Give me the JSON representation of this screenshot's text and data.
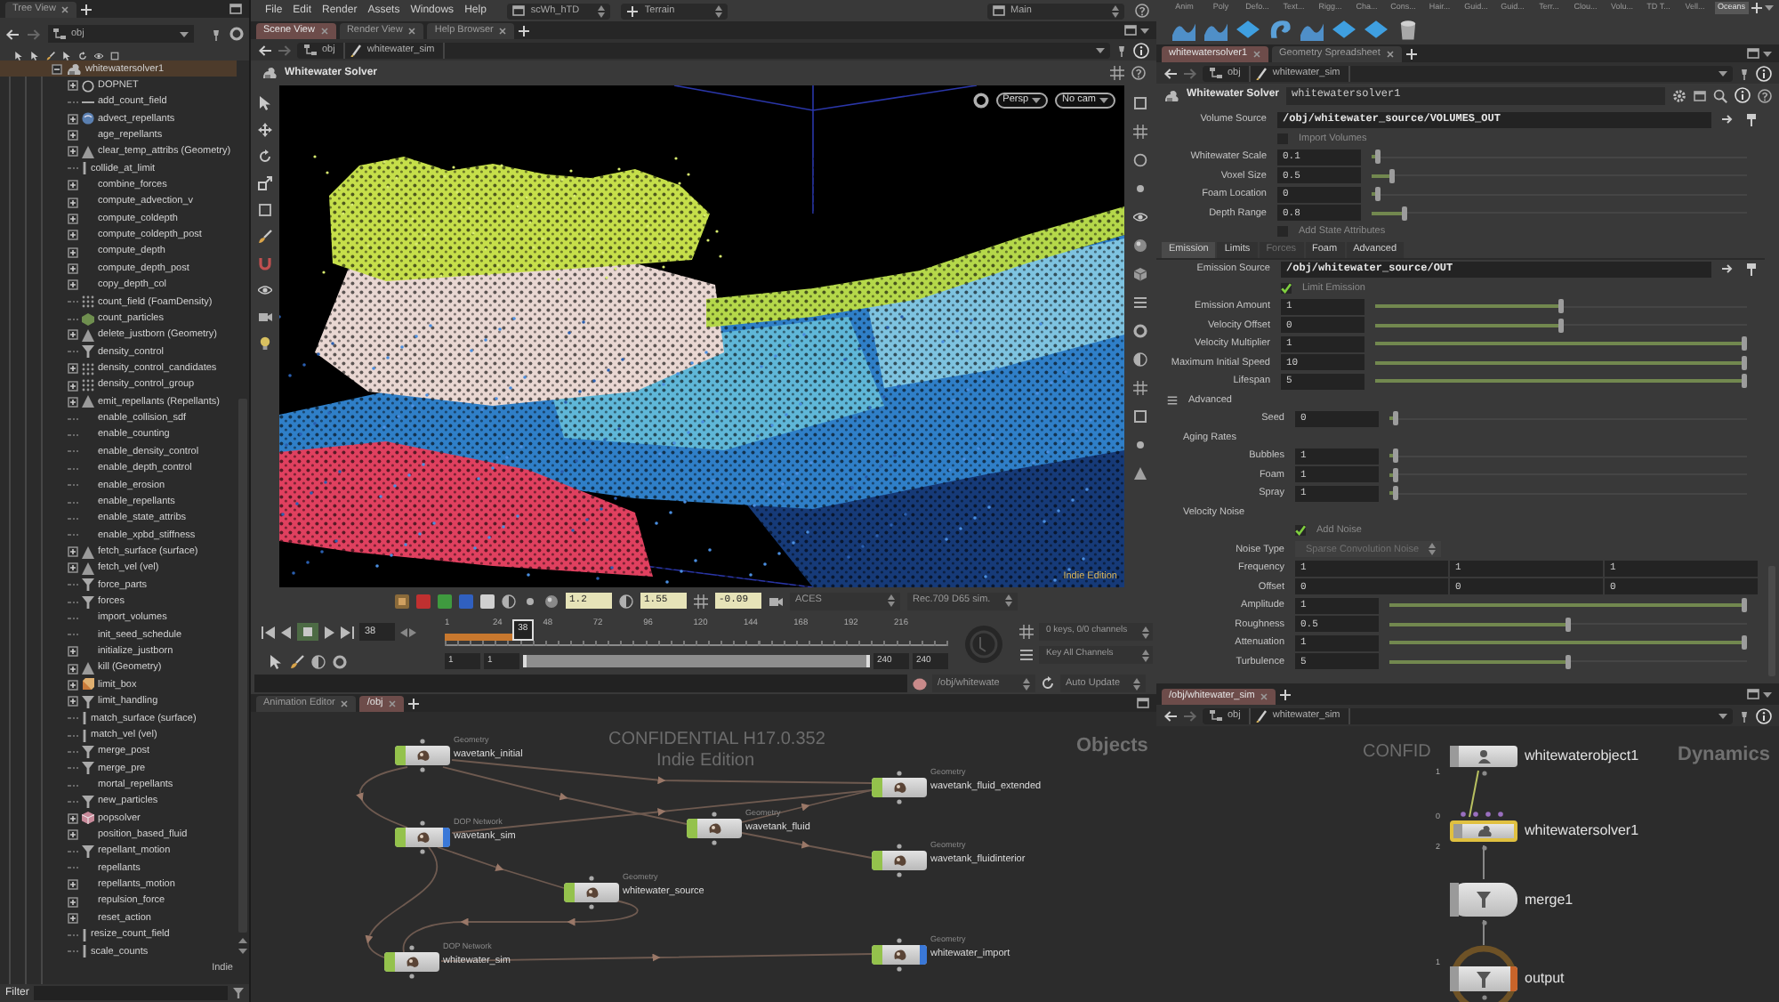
{
  "tree_view": {
    "tab": "Tree View",
    "path": "obj",
    "root": {
      "label": "whitewatersolver1",
      "expanded": true,
      "selected": true,
      "children": [
        {
          "label": "DOPNET",
          "expandable": true,
          "kind": "dopnet",
          "selected": false
        },
        {
          "label": "add_count_field",
          "expandable": false,
          "kind": "dash",
          "selected": false
        },
        {
          "label": "advect_repellants",
          "expandable": true,
          "kind": "sphere",
          "selected": false
        },
        {
          "label": "age_repellants",
          "expandable": true,
          "kind": "none",
          "selected": false
        },
        {
          "label": "clear_temp_attribs (Geometry)",
          "expandable": true,
          "kind": "cone",
          "selected": false
        },
        {
          "label": "collide_at_limit",
          "expandable": false,
          "kind": "bar",
          "selected": false
        },
        {
          "label": "combine_forces",
          "expandable": true,
          "kind": "none",
          "selected": false
        },
        {
          "label": "compute_advection_v",
          "expandable": true,
          "kind": "none",
          "selected": false
        },
        {
          "label": "compute_coldepth",
          "expandable": true,
          "kind": "none",
          "selected": false
        },
        {
          "label": "compute_coldepth_post",
          "expandable": true,
          "kind": "none",
          "selected": false
        },
        {
          "label": "compute_depth",
          "expandable": true,
          "kind": "none",
          "selected": false
        },
        {
          "label": "compute_depth_post",
          "expandable": true,
          "kind": "none",
          "selected": false
        },
        {
          "label": "copy_depth_col",
          "expandable": true,
          "kind": "none",
          "selected": false
        },
        {
          "label": "count_field (FoamDensity)",
          "expandable": false,
          "kind": "dots",
          "selected": false
        },
        {
          "label": "count_particles",
          "expandable": false,
          "kind": "hexagon",
          "selected": false
        },
        {
          "label": "delete_justborn (Geometry)",
          "expandable": true,
          "kind": "cone",
          "selected": false
        },
        {
          "label": "density_control",
          "expandable": false,
          "kind": "funnel",
          "selected": false
        },
        {
          "label": "density_control_candidates",
          "expandable": true,
          "kind": "dots",
          "selected": false
        },
        {
          "label": "density_control_group",
          "expandable": true,
          "kind": "dots",
          "selected": false
        },
        {
          "label": "emit_repellants (Repellants)",
          "expandable": true,
          "kind": "cone",
          "selected": false
        },
        {
          "label": "enable_collision_sdf",
          "expandable": false,
          "kind": "none",
          "selected": false
        },
        {
          "label": "enable_counting",
          "expandable": false,
          "kind": "none",
          "selected": false
        },
        {
          "label": "enable_density_control",
          "expandable": false,
          "kind": "none",
          "selected": false
        },
        {
          "label": "enable_depth_control",
          "expandable": false,
          "kind": "none",
          "selected": false
        },
        {
          "label": "enable_erosion",
          "expandable": false,
          "kind": "none",
          "selected": false
        },
        {
          "label": "enable_repellants",
          "expandable": false,
          "kind": "none",
          "selected": false
        },
        {
          "label": "enable_state_attribs",
          "expandable": false,
          "kind": "none",
          "selected": false
        },
        {
          "label": "enable_xpbd_stiffness",
          "expandable": false,
          "kind": "none",
          "selected": false
        },
        {
          "label": "fetch_surface (surface)",
          "expandable": true,
          "kind": "cone",
          "selected": false
        },
        {
          "label": "fetch_vel (vel)",
          "expandable": true,
          "kind": "cone",
          "selected": false
        },
        {
          "label": "force_parts",
          "expandable": false,
          "kind": "funnel",
          "selected": false
        },
        {
          "label": "forces",
          "expandable": false,
          "kind": "funnel",
          "selected": false
        },
        {
          "label": "import_volumes",
          "expandable": false,
          "kind": "none",
          "selected": false
        },
        {
          "label": "init_seed_schedule",
          "expandable": false,
          "kind": "none",
          "selected": false
        },
        {
          "label": "initialize_justborn",
          "expandable": true,
          "kind": "none",
          "selected": false
        },
        {
          "label": "kill (Geometry)",
          "expandable": true,
          "kind": "cone",
          "selected": false
        },
        {
          "label": "limit_box",
          "expandable": true,
          "kind": "box",
          "selected": false
        },
        {
          "label": "limit_handling",
          "expandable": true,
          "kind": "funnel",
          "selected": false
        },
        {
          "label": "match_surface (surface)",
          "expandable": false,
          "kind": "bar",
          "selected": false
        },
        {
          "label": "match_vel (vel)",
          "expandable": false,
          "kind": "bar",
          "selected": false
        },
        {
          "label": "merge_post",
          "expandable": false,
          "kind": "funnel",
          "selected": false
        },
        {
          "label": "merge_pre",
          "expandable": false,
          "kind": "funnel",
          "selected": false
        },
        {
          "label": "mortal_repellants",
          "expandable": false,
          "kind": "none",
          "selected": false
        },
        {
          "label": "new_particles",
          "expandable": false,
          "kind": "funnel",
          "selected": false
        },
        {
          "label": "popsolver",
          "expandable": true,
          "kind": "cube",
          "selected": false
        },
        {
          "label": "position_based_fluid",
          "expandable": true,
          "kind": "none",
          "selected": false
        },
        {
          "label": "repellant_motion",
          "expandable": false,
          "kind": "funnel",
          "selected": false
        },
        {
          "label": "repellants",
          "expandable": false,
          "kind": "none",
          "selected": false
        },
        {
          "label": "repellants_motion",
          "expandable": true,
          "kind": "none",
          "selected": false
        },
        {
          "label": "repulsion_force",
          "expandable": true,
          "kind": "none",
          "selected": false
        },
        {
          "label": "reset_action",
          "expandable": true,
          "kind": "none",
          "selected": false
        },
        {
          "label": "resize_count_field",
          "expandable": false,
          "kind": "bar",
          "selected": false
        },
        {
          "label": "scale_counts",
          "expandable": false,
          "kind": "bar",
          "selected": false
        }
      ]
    },
    "edition_label": "Indie",
    "filter_label": "Filter"
  },
  "menu_bar": {
    "items": [
      "File",
      "Edit",
      "Render",
      "Assets",
      "Windows",
      "Help"
    ],
    "desktop": "scWh_hTD",
    "context": "Terrain",
    "workspace": "Main"
  },
  "scene_tabs": [
    {
      "label": "Scene View",
      "selected": true
    },
    {
      "label": "Render View",
      "selected": false
    },
    {
      "label": "Help Browser",
      "selected": false
    }
  ],
  "scene_path": [
    "obj",
    "whitewater_sim"
  ],
  "viewport": {
    "title": "Whitewater Solver",
    "view_menu": "Persp",
    "camera_menu": "No cam",
    "edition_label": "Indie Edition"
  },
  "display_bar": {
    "fields": [
      "1.2",
      "1.55",
      "-0.09"
    ],
    "color_space": "ACES",
    "display": "Rec.709 D65 sim."
  },
  "timeline": {
    "frame": "38",
    "marker": "38",
    "ruler_labels": [
      "1",
      "24",
      "48",
      "72",
      "96",
      "120",
      "144",
      "168",
      "192",
      "216"
    ],
    "level": 0.155,
    "keys_info": "0 keys, 0/0 channels",
    "key_all": "Key All Channels",
    "range": [
      "1",
      "1",
      "240",
      "240"
    ]
  },
  "status_bar": {
    "path": "/obj/whitewate",
    "update_mode": "Auto Update"
  },
  "network_left": {
    "tabs": [
      {
        "label": "Animation Editor",
        "selected": false
      },
      {
        "label": "/obj",
        "selected": true
      }
    ],
    "context_label": "Objects",
    "notice": [
      "CONFIDENTIAL H17.0.352",
      "Indie Edition"
    ],
    "nodes": [
      {
        "type": "Geometry",
        "name": "wavetank_initial",
        "display": false,
        "selected": false
      },
      {
        "type": "DOP Network",
        "name": "wavetank_sim",
        "display": true,
        "selected": false
      },
      {
        "type": "Geometry",
        "name": "wavetank_fluid",
        "display": false,
        "selected": false
      },
      {
        "type": "Geometry",
        "name": "wavetank_fluid_extended",
        "display": false,
        "selected": false
      },
      {
        "type": "Geometry",
        "name": "wavetank_fluidinterior",
        "display": false,
        "selected": false
      },
      {
        "type": "Geometry",
        "name": "whitewater_source",
        "display": false,
        "selected": false
      },
      {
        "type": "DOP Network",
        "name": "whitewater_sim",
        "display": false,
        "selected": false
      },
      {
        "type": "Geometry",
        "name": "whitewater_import",
        "display": true,
        "selected": false
      }
    ]
  },
  "shelf": {
    "tabs": [
      {
        "label": "Anim",
        "selected": false
      },
      {
        "label": "Poly",
        "selected": false
      },
      {
        "label": "Defo...",
        "selected": false
      },
      {
        "label": "Text...",
        "selected": false
      },
      {
        "label": "Rigg...",
        "selected": false
      },
      {
        "label": "Cha...",
        "selected": false
      },
      {
        "label": "Cons...",
        "selected": false
      },
      {
        "label": "Hair...",
        "selected": false
      },
      {
        "label": "Guid...",
        "selected": false
      },
      {
        "label": "Guid...",
        "selected": false
      },
      {
        "label": "Terr...",
        "selected": false
      },
      {
        "label": "Clou...",
        "selected": false
      },
      {
        "label": "Volu...",
        "selected": false
      },
      {
        "label": "TD T...",
        "selected": false
      },
      {
        "label": "Vell...",
        "selected": false
      },
      {
        "label": "Oceans",
        "selected": true
      }
    ]
  },
  "parameter_pane": {
    "tabs": [
      {
        "label": "whitewatersolver1",
        "selected": true
      },
      {
        "label": "Geometry Spreadsheet",
        "selected": false
      }
    ],
    "path": [
      "obj",
      "whitewater_sim"
    ],
    "node_type": "Whitewater Solver",
    "node_name": "whitewatersolver1",
    "params": [
      {
        "kind": "path",
        "label": "Volume Source",
        "value": "/obj/whitewater_source/VOLUMES_OUT"
      },
      {
        "kind": "toggle",
        "label": "Import Volumes",
        "checked": false
      },
      {
        "kind": "slider",
        "label": "Whitewater Scale",
        "value": "0.1",
        "level": 0.01
      },
      {
        "kind": "slider",
        "label": "Voxel Size",
        "value": "0.5",
        "level": 0.05
      },
      {
        "kind": "slider",
        "label": "Foam Location",
        "value": "0",
        "level": 0.01
      },
      {
        "kind": "slider",
        "label": "Depth Range",
        "value": "0.8",
        "level": 0.08
      },
      {
        "kind": "toggle",
        "label": "Add State Attributes",
        "checked": false
      }
    ],
    "folder_tabs": [
      {
        "label": "Emission",
        "selected": true,
        "disabled": false
      },
      {
        "label": "Limits",
        "selected": false,
        "disabled": false
      },
      {
        "label": "Forces",
        "selected": false,
        "disabled": true
      },
      {
        "label": "Foam",
        "selected": false,
        "disabled": false
      },
      {
        "label": "Advanced",
        "selected": false,
        "disabled": false
      }
    ],
    "folder_params": [
      {
        "kind": "path",
        "label": "Emission Source",
        "value": "/obj/whitewater_source/OUT"
      },
      {
        "kind": "toggle",
        "label": "Limit Emission",
        "checked": true
      },
      {
        "kind": "slider",
        "label": "Emission Amount",
        "value": "1",
        "level": 0.5
      },
      {
        "kind": "slider",
        "label": "Velocity Offset",
        "value": "0",
        "level": 0.5
      },
      {
        "kind": "slider",
        "label": "Velocity Multiplier",
        "value": "1",
        "level": 1
      },
      {
        "kind": "slider",
        "label": "Maximum Initial Speed",
        "value": "10",
        "level": 1
      },
      {
        "kind": "slider",
        "label": "Lifespan",
        "value": "5",
        "level": 1
      }
    ],
    "advanced": {
      "label": "Advanced",
      "expanded": true,
      "params": [
        {
          "kind": "slider",
          "label": "Seed",
          "value": "0",
          "level": 0.01
        },
        {
          "kind": "heading",
          "label": "Aging Rates"
        },
        {
          "kind": "slider",
          "label": "Bubbles",
          "value": "1",
          "level": 0.01
        },
        {
          "kind": "slider",
          "label": "Foam",
          "value": "1",
          "level": 0.01
        },
        {
          "kind": "slider",
          "label": "Spray",
          "value": "1",
          "level": 0.01
        },
        {
          "kind": "heading",
          "label": "Velocity Noise"
        },
        {
          "kind": "toggle",
          "label": "Add Noise",
          "checked": true
        },
        {
          "kind": "menu",
          "label": "Noise Type",
          "value": "Sparse Convolution Noise",
          "disabled": true
        },
        {
          "kind": "vector",
          "label": "Frequency",
          "values": [
            "1",
            "1",
            "1"
          ]
        },
        {
          "kind": "vector",
          "label": "Offset",
          "values": [
            "0",
            "0",
            "0"
          ]
        },
        {
          "kind": "slider",
          "label": "Amplitude",
          "value": "1",
          "level": 1
        },
        {
          "kind": "slider",
          "label": "Roughness",
          "value": "0.5",
          "level": 0.5
        },
        {
          "kind": "slider",
          "label": "Attenuation",
          "value": "1",
          "level": 1
        },
        {
          "kind": "slider",
          "label": "Turbulence",
          "value": "5",
          "level": 0.5
        }
      ]
    }
  },
  "network_right": {
    "tabs": [
      {
        "label": "/obj/whitewater_sim",
        "selected": true
      }
    ],
    "path": [
      "obj",
      "whitewater_sim"
    ],
    "context_label": "Dynamics",
    "notice": "CONFID",
    "nodes": [
      {
        "name": "whitewaterobject1",
        "kind": "object",
        "selected": false,
        "display": false,
        "output_label": "1"
      },
      {
        "name": "whitewatersolver1",
        "kind": "solver",
        "selected": true,
        "display": false,
        "input_label": "0",
        "output_label": "2"
      },
      {
        "name": "merge1",
        "kind": "merge",
        "selected": false,
        "display": false
      },
      {
        "name": "output",
        "kind": "output",
        "selected": false,
        "display": true,
        "input_label": "1"
      }
    ]
  }
}
